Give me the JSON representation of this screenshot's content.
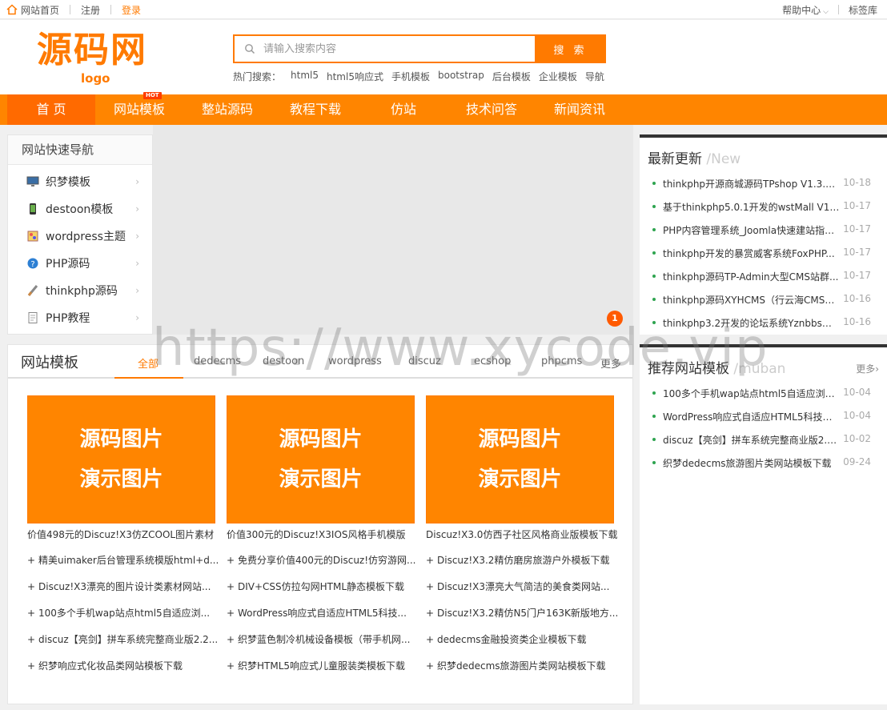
{
  "topbar": {
    "home": "网站首页",
    "register": "注册",
    "login": "登录",
    "help": "帮助中心",
    "tags": "标签库"
  },
  "header": {
    "logo_text": "源码网",
    "logo_sub": "logo",
    "search_placeholder": "请输入搜索内容",
    "search_button": "搜 索",
    "hot_label": "热门搜索：",
    "hot_terms": [
      "html5",
      "html5响应式",
      "手机模板",
      "bootstrap",
      "后台模板",
      "企业模板",
      "导航"
    ]
  },
  "nav": {
    "items": [
      "首 页",
      "网站模板",
      "整站源码",
      "教程下载",
      "仿站",
      "技术问答",
      "新闻资讯"
    ],
    "hot_badge": "HOT",
    "active_index": 0
  },
  "quick_nav": {
    "title": "网站快速导航",
    "items": [
      "织梦模板",
      "destoon模板",
      "wordpress主题",
      "PHP源码",
      "thinkphp源码",
      "PHP教程"
    ]
  },
  "banner_badge": "1",
  "templates": {
    "title": "网站模板",
    "tabs": [
      "全部",
      "dedecms",
      "destoon",
      "wordpress",
      "discuz",
      "ecshop",
      "phpcms",
      "更多"
    ],
    "card_text_1": "源码图片",
    "card_text_2": "演示图片",
    "cards": [
      "价值498元的Discuz!X3仿ZCOOL图片素材",
      "价值300元的Discuz!X3IOS风格手机模版",
      "Discuz!X3.0仿西子社区风格商业版模板下载"
    ],
    "columns": [
      [
        "精美uimaker后台管理系统模版html+d...",
        "Discuz!X3漂亮的图片设计类素材网站...",
        "100多个手机wap站点html5自适应浏...",
        "discuz【亮剑】拼车系统完整商业版2.2...",
        "织梦响应式化妆品类网站模板下载"
      ],
      [
        "免费分享价值400元的Discuz!仿穷游网...",
        "DIV+CSS仿拉勾网HTML静态模板下载",
        "WordPress响应式自适应HTML5科技...",
        "织梦蓝色制冷机械设备模板（带手机网...",
        "织梦HTML5响应式儿童服装类模板下载"
      ],
      [
        "Discuz!X3.2精仿磨房旅游户外模板下载",
        "Discuz!X3漂亮大气简洁的美食类网站...",
        "Discuz!X3.2精仿N5门户163K新版地方...",
        "dedecms金融投资类企业模板下载",
        "织梦dedecms旅游图片类网站模板下载"
      ]
    ]
  },
  "news": {
    "title": "最新更新",
    "title_en": "/New",
    "items": [
      {
        "t": "thinkphp开源商城源码TPshop V1.3.1...",
        "d": "10-18"
      },
      {
        "t": "基于thinkphp5.0.1开发的wstMall V1.7...",
        "d": "10-17"
      },
      {
        "t": "PHP内容管理系统_Joomla快速建站指南...",
        "d": "10-17"
      },
      {
        "t": "thinkphp开发的暴赏威客系统FoxPHP...",
        "d": "10-17"
      },
      {
        "t": "thinkphp源码TP-Admin大型CMS站群...",
        "d": "10-17"
      },
      {
        "t": "thinkphp源码XYHCMS（行云海CMS）...",
        "d": "10-16"
      },
      {
        "t": "thinkphp3.2开发的论坛系统Yznbbs论...",
        "d": "10-16"
      }
    ]
  },
  "recommend": {
    "title": "推荐网站模板",
    "title_en": "/muban",
    "more": "更多›",
    "items": [
      {
        "t": "100多个手机wap站点html5自适应浏览...",
        "d": "10-04"
      },
      {
        "t": "WordPress响应式自适应HTML5科技资...",
        "d": "10-04"
      },
      {
        "t": "discuz【亮剑】拼车系统完整商业版2.2...",
        "d": "10-02"
      },
      {
        "t": "织梦dedecms旅游图片类网站模板下载",
        "d": "09-24"
      }
    ]
  },
  "watermark": "https://www.xycode.vip"
}
